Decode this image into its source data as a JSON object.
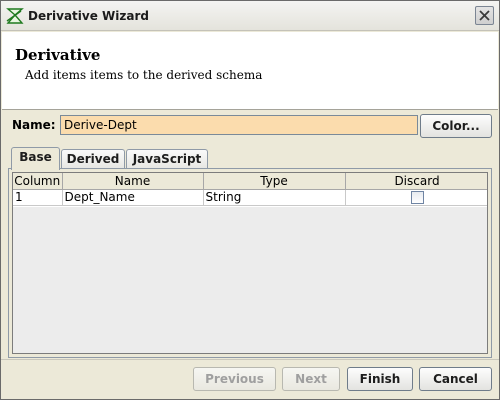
{
  "window": {
    "title": "Derivative Wizard",
    "icons": {
      "app": "derivative-wizard-icon",
      "close": "close-icon"
    }
  },
  "header": {
    "title": "Derivative",
    "description": "Add items items to the derived schema"
  },
  "name_field": {
    "label": "Name:",
    "value": "Derive-Dept"
  },
  "color_button": {
    "label": "Color..."
  },
  "tabs": [
    {
      "label": "Base",
      "active": true
    },
    {
      "label": "Derived",
      "active": false
    },
    {
      "label": "JavaScript",
      "active": false
    }
  ],
  "table": {
    "columns": [
      "Column",
      "Name",
      "Type",
      "Discard"
    ],
    "rows": [
      {
        "column": "1",
        "name": "Dept_Name",
        "type": "String",
        "discard": false
      }
    ]
  },
  "buttons": {
    "previous": {
      "label": "Previous",
      "enabled": false
    },
    "next": {
      "label": "Next",
      "enabled": false
    },
    "finish": {
      "label": "Finish",
      "enabled": true
    },
    "cancel": {
      "label": "Cancel",
      "enabled": true
    }
  },
  "colors": {
    "name_field_background": "#fbdcad",
    "header_background": "#ffffff",
    "dialog_background": "#ece9d8"
  }
}
